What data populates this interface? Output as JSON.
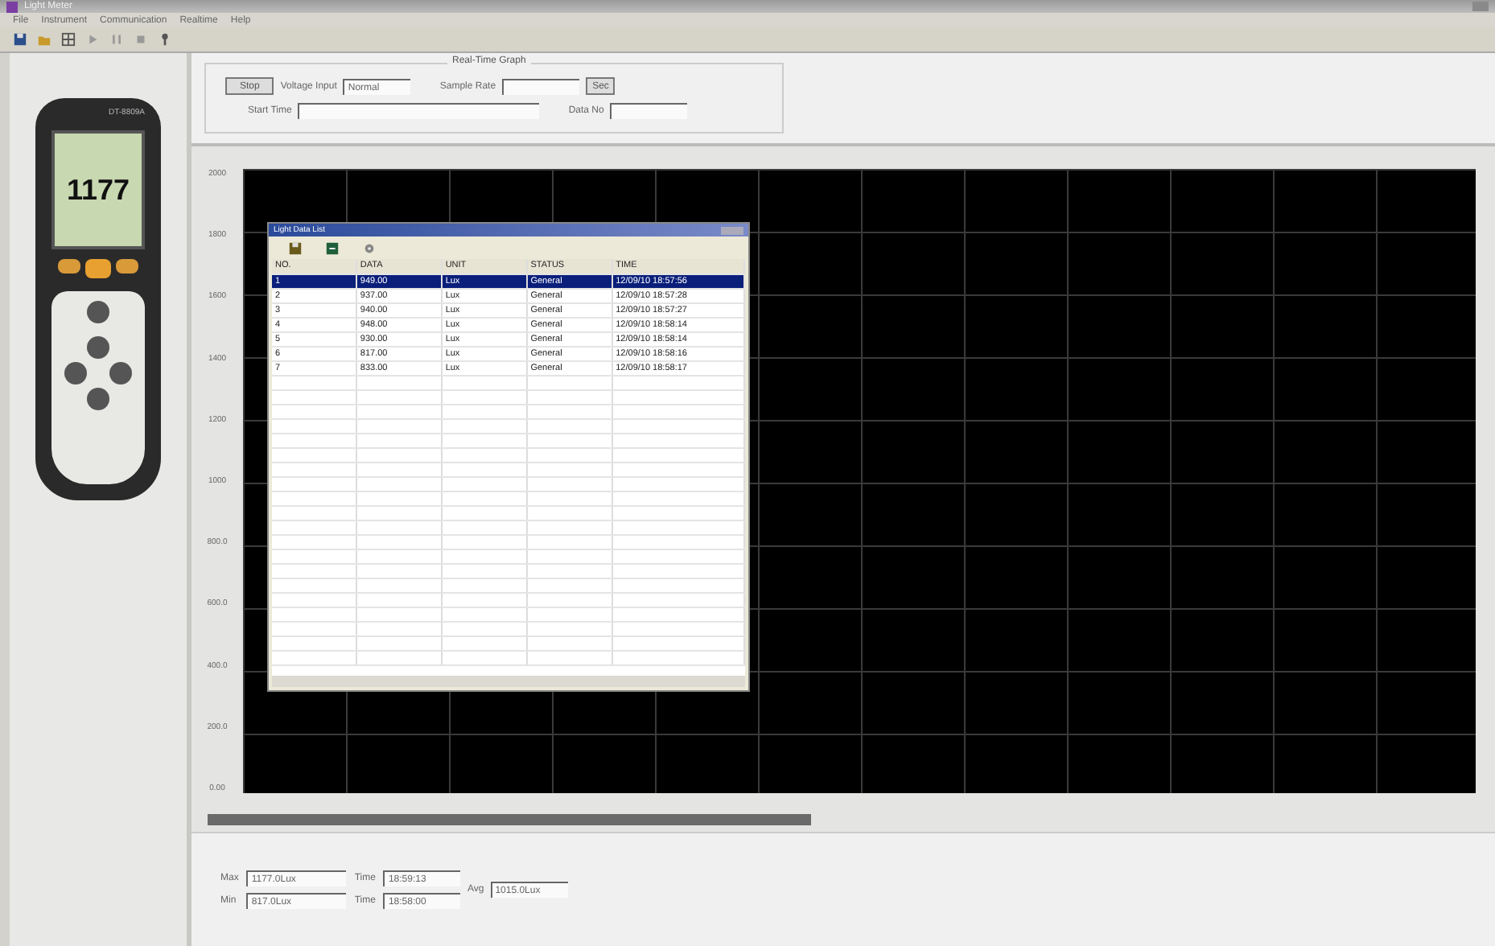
{
  "window": {
    "title": "Light Meter"
  },
  "menu": [
    "File",
    "Instrument",
    "Communication",
    "Realtime",
    "Help"
  ],
  "meter": {
    "model": "DT-8809A",
    "reading": "1177"
  },
  "control_panel": {
    "title": "Real-Time Graph",
    "button": "Stop",
    "voltage_label": "Voltage Input",
    "voltage_value": "Normal",
    "sample_rate_label": "Sample Rate",
    "unit": "Sec",
    "start_time_label": "Start Time",
    "data_no_label": "Data No"
  },
  "graph": {
    "y_labels": [
      "2000",
      "1800",
      "1600",
      "1400",
      "1200",
      "1000",
      "800.0",
      "600.0",
      "400.0",
      "200.0",
      "0.00"
    ]
  },
  "data_list": {
    "title": "Light Data List",
    "columns": [
      "NO.",
      "DATA",
      "UNIT",
      "STATUS",
      "TIME"
    ],
    "rows": [
      {
        "cells": [
          "1",
          "949.00",
          "Lux",
          "General",
          "12/09/10 18:57:56"
        ],
        "selected": true
      },
      {
        "cells": [
          "2",
          "937.00",
          "Lux",
          "General",
          "12/09/10 18:57:28"
        ],
        "selected": false
      },
      {
        "cells": [
          "3",
          "940.00",
          "Lux",
          "General",
          "12/09/10 18:57:27"
        ],
        "selected": false
      },
      {
        "cells": [
          "4",
          "948.00",
          "Lux",
          "General",
          "12/09/10 18:58:14"
        ],
        "selected": false
      },
      {
        "cells": [
          "5",
          "930.00",
          "Lux",
          "General",
          "12/09/10 18:58:14"
        ],
        "selected": false
      },
      {
        "cells": [
          "6",
          "817.00",
          "Lux",
          "General",
          "12/09/10 18:58:16"
        ],
        "selected": false
      },
      {
        "cells": [
          "7",
          "833.00",
          "Lux",
          "General",
          "12/09/10 18:58:17"
        ],
        "selected": false
      }
    ]
  },
  "stats": {
    "max_label": "Max",
    "max_value": "1177.0Lux",
    "max_time_label": "Time",
    "max_time": "18:59:13",
    "min_label": "Min",
    "min_value": "817.0Lux",
    "min_time_label": "Time",
    "min_time": "18:58:00",
    "avg_label": "Avg",
    "avg_value": "1015.0Lux"
  }
}
